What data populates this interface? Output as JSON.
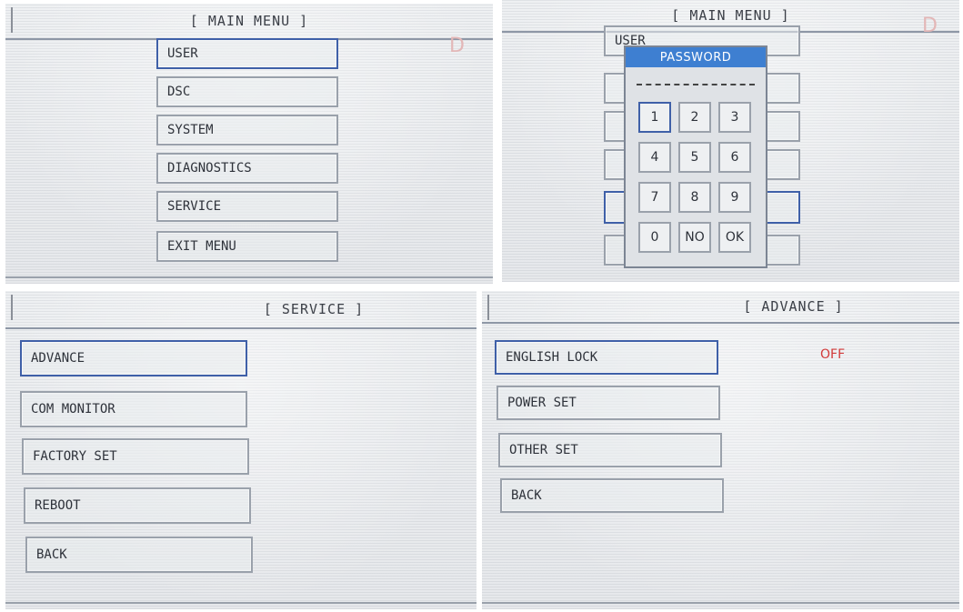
{
  "panel_main": {
    "header": "[ MAIN MENU ]",
    "items": [
      "USER",
      "DSC",
      "SYSTEM",
      "DIAGNOSTICS",
      "SERVICE",
      "EXIT MENU"
    ],
    "corner_mark": "D"
  },
  "panel_password": {
    "header": "[ MAIN MENU ]",
    "behind_item": "USER",
    "corner_mark": "D",
    "dialog": {
      "title": "PASSWORD",
      "keys": [
        "1",
        "2",
        "3",
        "4",
        "5",
        "6",
        "7",
        "8",
        "9",
        "0",
        "NO",
        "OK"
      ]
    }
  },
  "panel_service": {
    "header": "[ SERVICE ]",
    "items": [
      "ADVANCE",
      "COM MONITOR",
      "FACTORY SET",
      "REBOOT",
      "BACK"
    ]
  },
  "panel_advance": {
    "header": "[ ADVANCE ]",
    "items": [
      "ENGLISH LOCK",
      "POWER SET",
      "OTHER SET",
      "BACK"
    ],
    "english_lock_value": "OFF"
  },
  "colors": {
    "selected_border": "#3f60a8",
    "dialog_title_bg": "#3e7fd1",
    "status_off": "#d23a3a"
  }
}
